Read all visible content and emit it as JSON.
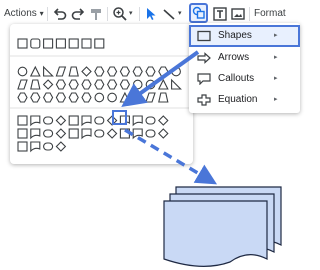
{
  "toolbar": {
    "actions_label": "Actions",
    "actions_caret": "▾",
    "format_options_label": "Format optio"
  },
  "shapes_menu": {
    "items": [
      {
        "label": "Shapes",
        "icon": "rectangle-icon",
        "arrow": "▸"
      },
      {
        "label": "Arrows",
        "icon": "arrow-icon",
        "arrow": "▸"
      },
      {
        "label": "Callouts",
        "icon": "callout-icon",
        "arrow": "▸"
      },
      {
        "label": "Equation",
        "icon": "plus-icon",
        "arrow": "▸"
      }
    ]
  },
  "colors": {
    "highlight": "#4a76d8",
    "icon": "#3c4043",
    "document_shape_fill": "#c9d9f5"
  }
}
